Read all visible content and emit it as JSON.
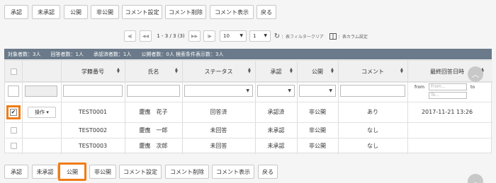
{
  "toolbar": {
    "buttons": [
      "承認",
      "未承認",
      "公開",
      "非公開",
      "コメント設定",
      "コメント削除",
      "コメント表示",
      "戻る"
    ]
  },
  "pager": {
    "page_info": "1 - 3 / 3 (3)",
    "per_page": "10",
    "page": "1",
    "filter_clear": "：表フィルタークリア",
    "column_setting": "：表カラム設定"
  },
  "summary": "対象者数：3人　　回答者数：1人　　承認済者数：1人　　公開者数：0人 検索条件表示数：3人",
  "table": {
    "headers": [
      "学籍番号",
      "氏名",
      "ステータス",
      "承認",
      "公開",
      "コメント",
      "最終回答日時"
    ],
    "date_filter": {
      "from_label": "from",
      "to_label": "to",
      "from_placeholder": "From...",
      "to_placeholder": "To..."
    },
    "action_label": "操作",
    "rows": [
      {
        "id": "TEST0001",
        "name": "慶應　花子",
        "status": "回答済",
        "approval": "承認済",
        "publish": "非公開",
        "comment": "あり",
        "date": "2017-11-21 13:26",
        "checked": true
      },
      {
        "id": "TEST0002",
        "name": "慶應　一郎",
        "status": "未回答",
        "approval": "未承認",
        "publish": "非公開",
        "comment": "なし",
        "date": "",
        "checked": false
      },
      {
        "id": "TEST0003",
        "name": "慶應　次郎",
        "status": "未回答",
        "approval": "未承認",
        "publish": "非公開",
        "comment": "なし",
        "date": "",
        "checked": false
      }
    ]
  },
  "colors": {
    "highlight": "#f07c16",
    "summary_bg": "#6a7a8a"
  }
}
